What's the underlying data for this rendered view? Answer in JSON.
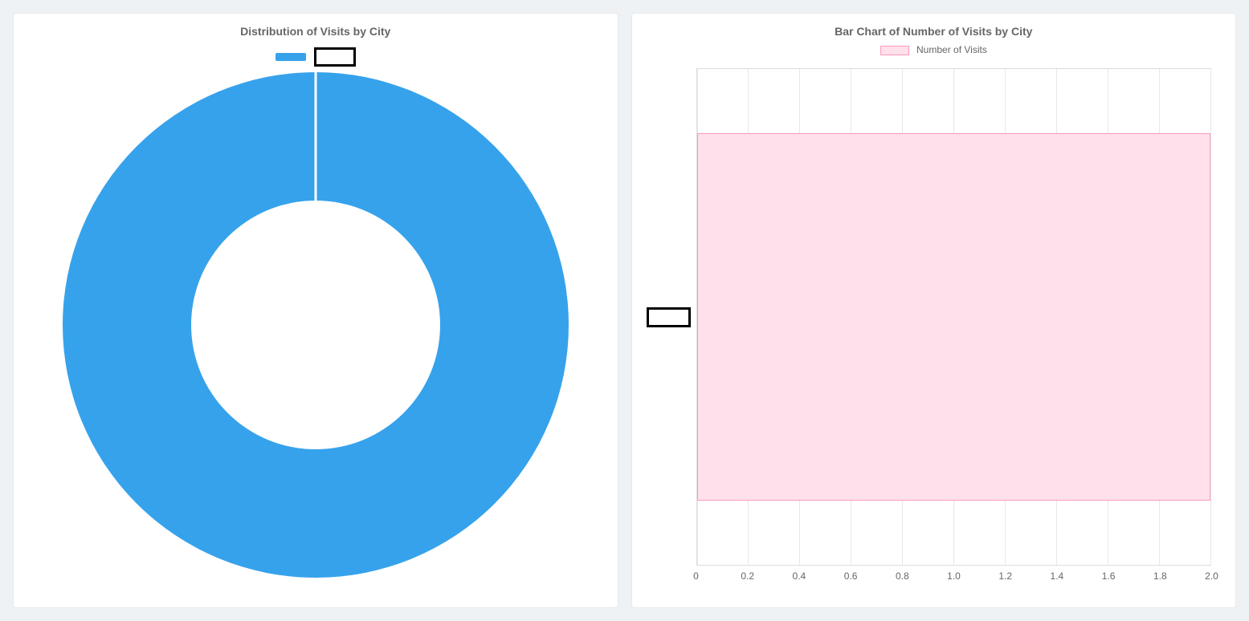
{
  "left": {
    "title": "Distribution of Visits by City",
    "legend_label": "",
    "colors": {
      "segment": "#36a2eb"
    }
  },
  "right": {
    "title": "Bar Chart of Number of Visits by City",
    "legend_label": "Number of Visits",
    "y_category_label": "",
    "colors": {
      "bar_fill": "#ffe0eb",
      "bar_border": "#ff9ab8"
    },
    "x_ticks": [
      "0",
      "0.2",
      "0.4",
      "0.6",
      "0.8",
      "1.0",
      "1.2",
      "1.4",
      "1.6",
      "1.8",
      "2.0"
    ]
  },
  "chart_data": [
    {
      "type": "pie",
      "title": "Distribution of Visits by City",
      "categories": [
        ""
      ],
      "values": [
        100
      ],
      "donut": true,
      "legend_position": "top"
    },
    {
      "type": "bar",
      "orientation": "horizontal",
      "title": "Bar Chart of Number of Visits by City",
      "series": [
        {
          "name": "Number of Visits",
          "values": [
            2.0
          ]
        }
      ],
      "categories": [
        ""
      ],
      "xlabel": "",
      "ylabel": "",
      "xlim": [
        0,
        2.0
      ],
      "x_ticks": [
        0,
        0.2,
        0.4,
        0.6,
        0.8,
        1.0,
        1.2,
        1.4,
        1.6,
        1.8,
        2.0
      ],
      "grid": true,
      "legend_position": "top"
    }
  ]
}
